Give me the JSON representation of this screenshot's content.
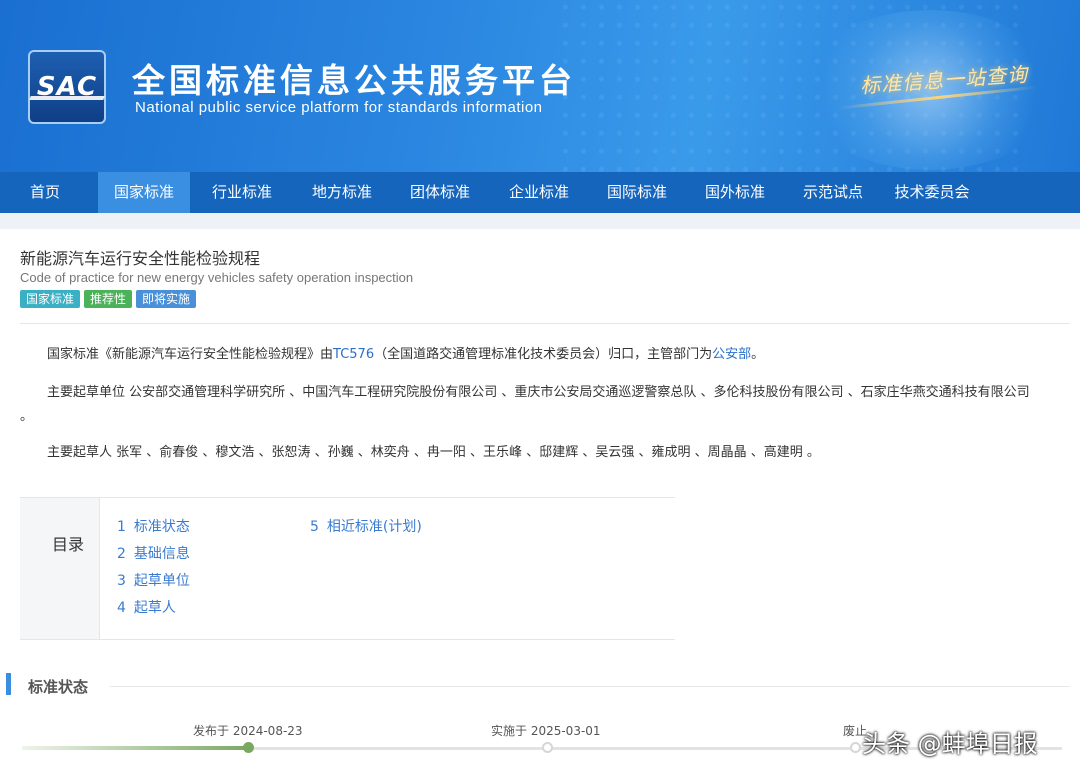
{
  "header": {
    "logo_text": "SAC",
    "title": "全国标准信息公共服务平台",
    "subtitle": "National public service platform  for standards information",
    "slogan": "标准信息一站查询"
  },
  "nav": {
    "items": [
      "首页",
      "国家标准",
      "行业标准",
      "地方标准",
      "团体标准",
      "企业标准",
      "国际标准",
      "国外标准",
      "示范试点",
      "技术委员会"
    ],
    "active_index": 1
  },
  "standard": {
    "title": "新能源汽车运行安全性能检验规程",
    "title_en": "Code of practice for new energy vehicles safety operation inspection",
    "tags": [
      "国家标准",
      "推荐性",
      "即将实施"
    ],
    "intro": {
      "prefix": "国家标准《新能源汽车运行安全性能检验规程》由",
      "tc_link": "TC576",
      "middle": "（全国道路交通管理标准化技术委员会）归口，主管部门为",
      "dept_link": "公安部",
      "suffix": "。"
    },
    "drafting_units": "主要起草单位 公安部交通管理科学研究所 、中国汽车工程研究院股份有限公司 、重庆市公安局交通巡逻警察总队 、多伦科技股份有限公司 、石家庄华燕交通科技有限公司",
    "drafting_units_end": "。",
    "drafters": "主要起草人 张军 、俞春俊 、穆文浩 、张恕涛 、孙巍 、林奕舟 、冉一阳 、王乐峰 、邸建辉 、吴云强 、雍成明 、周晶晶 、高建明 。"
  },
  "toc": {
    "label": "目录",
    "items": [
      {
        "num": "1",
        "label": "标准状态"
      },
      {
        "num": "2",
        "label": "基础信息"
      },
      {
        "num": "3",
        "label": "起草单位"
      },
      {
        "num": "4",
        "label": "起草人"
      },
      {
        "num": "5",
        "label": "相近标准(计划)"
      }
    ]
  },
  "status": {
    "section_title": "标准状态",
    "published": "发布于 2024-08-23",
    "effective": "实施于 2025-03-01",
    "abolished": "废止"
  },
  "watermark": "头条 @蚌埠日报"
}
